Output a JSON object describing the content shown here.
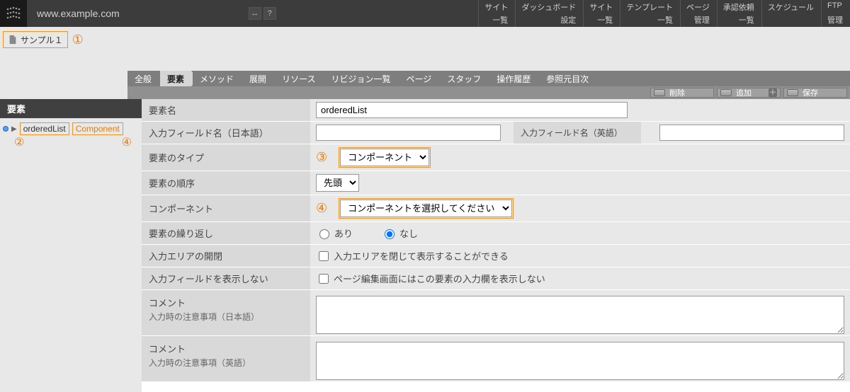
{
  "topbar": {
    "url": "www.example.com",
    "back_icon_label": "↔",
    "help_icon_label": "?",
    "menus": [
      {
        "title": "サイト",
        "sub": "一覧"
      },
      {
        "title": "ダッシュボード",
        "sub": "設定"
      },
      {
        "title": "サイト",
        "sub": "一覧"
      },
      {
        "title": "テンプレート",
        "sub": "一覧"
      },
      {
        "title": "ページ",
        "sub": "管理"
      },
      {
        "title": "承認依頼",
        "sub": "一覧"
      },
      {
        "title": "スケジュール",
        "sub": ""
      },
      {
        "title": "FTP",
        "sub": "管理"
      }
    ]
  },
  "breadcrumb": {
    "site_label": "サンプル１",
    "annot1": "①"
  },
  "tabs": {
    "items": [
      {
        "label": "全般"
      },
      {
        "label": "要素"
      },
      {
        "label": "メソッド"
      },
      {
        "label": "展開"
      },
      {
        "label": "リソース"
      },
      {
        "label": "リビジョン一覧"
      },
      {
        "label": "ページ"
      },
      {
        "label": "スタッフ"
      },
      {
        "label": "操作履歴"
      },
      {
        "label": "参照元目次"
      }
    ],
    "active_index": 1
  },
  "actions": {
    "delete": "削除",
    "add": "追加",
    "save": "保存"
  },
  "left": {
    "header": "要素",
    "item_name": "orderedList",
    "item_type": "Component",
    "annot2": "②",
    "annot4": "④"
  },
  "form": {
    "element_name": {
      "label": "要素名",
      "value": "orderedList"
    },
    "field_name_jp": {
      "label": "入力フィールド名（日本語）",
      "value": ""
    },
    "field_name_en": {
      "label": "入力フィールド名（英語）",
      "value": ""
    },
    "element_type": {
      "label": "要素のタイプ",
      "annot": "③",
      "options": [
        "コンポーネント"
      ],
      "selected": "コンポーネント"
    },
    "element_order": {
      "label": "要素の順序",
      "options": [
        "先頭"
      ],
      "selected": "先頭"
    },
    "component": {
      "label": "コンポーネント",
      "annot": "④",
      "options": [
        "コンポーネントを選択してください"
      ],
      "selected": "コンポーネントを選択してください"
    },
    "repeat": {
      "label": "要素の繰り返し",
      "opt_yes": "あり",
      "opt_no": "なし",
      "value": "no"
    },
    "area_collapse": {
      "label": "入力エリアの開閉",
      "checkbox_label": "入力エリアを閉じて表示することができる",
      "checked": false
    },
    "hide_field": {
      "label": "入力フィールドを表示しない",
      "checkbox_label": "ページ編集画面にはこの要素の入力欄を表示しない",
      "checked": false
    },
    "comment_jp": {
      "label1": "コメント",
      "label2": "入力時の注意事項（日本語）",
      "value": ""
    },
    "comment_en": {
      "label1": "コメント",
      "label2": "入力時の注意事項（英語）",
      "value": ""
    }
  }
}
